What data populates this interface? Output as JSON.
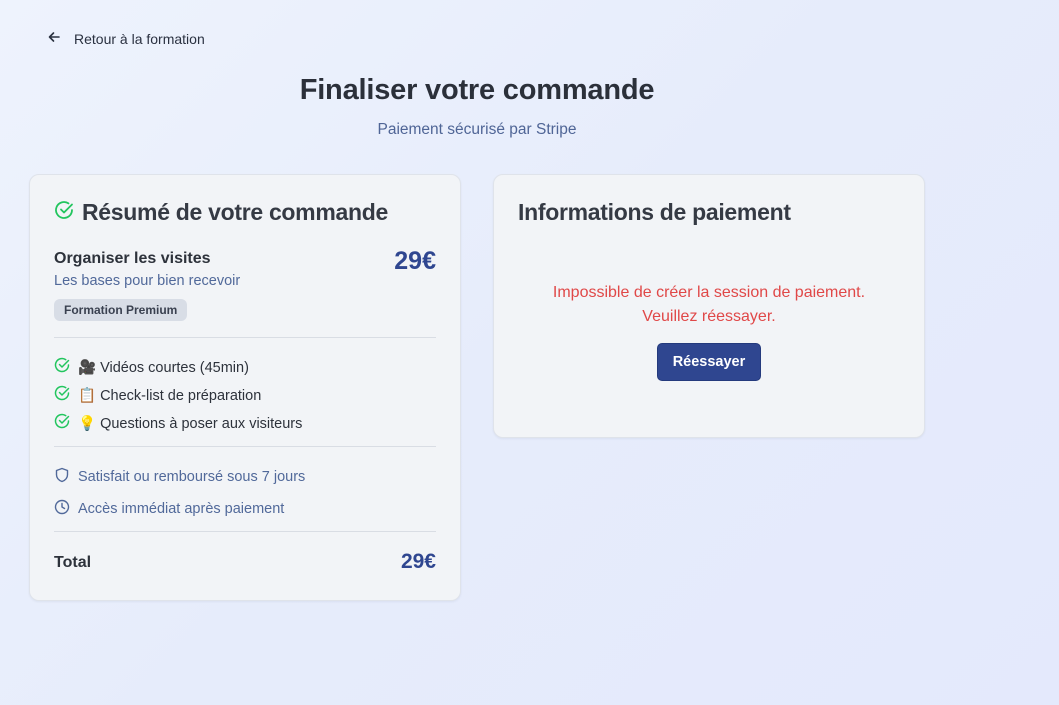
{
  "nav": {
    "back_label": "Retour à la formation"
  },
  "header": {
    "title": "Finaliser votre commande",
    "subtitle": "Paiement sécurisé par Stripe"
  },
  "summary": {
    "title": "Résumé de votre commande",
    "product": {
      "name": "Organiser les visites",
      "subtitle": "Les bases pour bien recevoir",
      "price": "29€",
      "badge": "Formation Premium"
    },
    "features": [
      {
        "label": "🎥 Vidéos courtes (45min)",
        "icon": "check-circle-icon"
      },
      {
        "label": "📋 Check-list de préparation",
        "icon": "check-circle-icon"
      },
      {
        "label": "💡 Questions à poser aux visiteurs",
        "icon": "check-circle-icon"
      }
    ],
    "guarantees": [
      {
        "label": "Satisfait ou remboursé sous 7 jours",
        "icon": "shield-icon"
      },
      {
        "label": "Accès immédiat après paiement",
        "icon": "clock-icon"
      }
    ],
    "total_label": "Total",
    "total_price": "29€"
  },
  "payment": {
    "title": "Informations de paiement",
    "error_line1": "Impossible de créer la session de paiement.",
    "error_line2": "Veuillez réessayer.",
    "retry_label": "Réessayer"
  },
  "colors": {
    "accent": "#2f4690",
    "success": "#22c55e",
    "error": "#e04848",
    "muted_text": "#51699a"
  }
}
